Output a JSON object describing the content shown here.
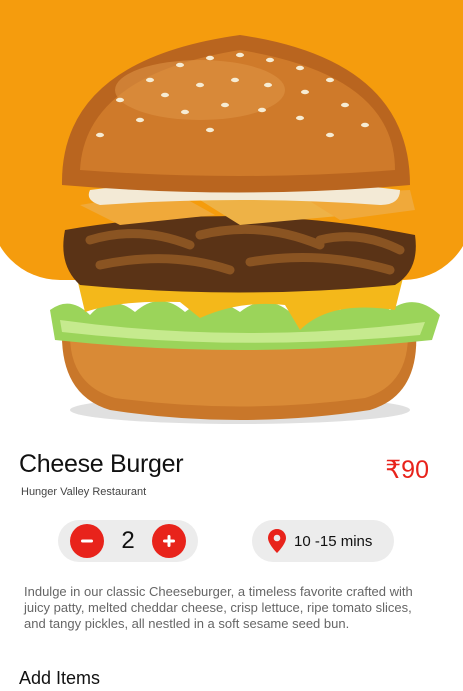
{
  "product": {
    "name": "Cheese Burger",
    "restaurant": "Hunger Valley Restaurant",
    "price": "₹90",
    "quantity": "2",
    "delivery_time": "10 -15 mins",
    "description": "Indulge in our classic Cheeseburger, a timeless favorite crafted with juicy  patty, melted cheddar cheese, crisp lettuce, ripe tomato slices, and tangy pickles, all nestled in a soft sesame seed bun."
  },
  "sections": {
    "add_items_heading": "Add Items"
  },
  "icons": {
    "decrease": "minus-icon",
    "increase": "plus-icon",
    "delivery": "location-pin-icon"
  },
  "colors": {
    "accent": "#e8231b",
    "hero_background": "#f59c0d",
    "pill_background": "#ececec"
  }
}
